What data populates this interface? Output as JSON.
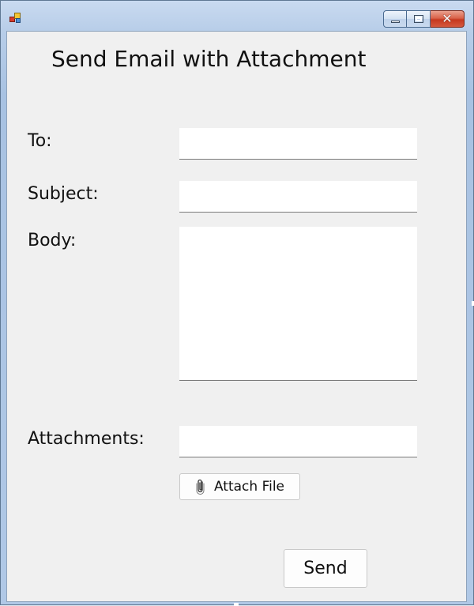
{
  "window": {
    "title_bar_icon": "app-icon",
    "caption_buttons": [
      "minimize-icon",
      "maximize-icon",
      "close-icon"
    ]
  },
  "form": {
    "title": "Send Email with Attachment",
    "to_label": "To:",
    "to_value": "",
    "subject_label": "Subject:",
    "subject_value": "",
    "body_label": "Body:",
    "body_value": "",
    "attachments_label": "Attachments:",
    "attachments_value": "",
    "attach_button_label": "Attach File",
    "attach_button_icon": "paperclip-icon",
    "send_button_label": "Send"
  },
  "colors": {
    "client_background": "#f0f0f0",
    "field_background": "#ffffff",
    "close_button": "#c6381f"
  }
}
